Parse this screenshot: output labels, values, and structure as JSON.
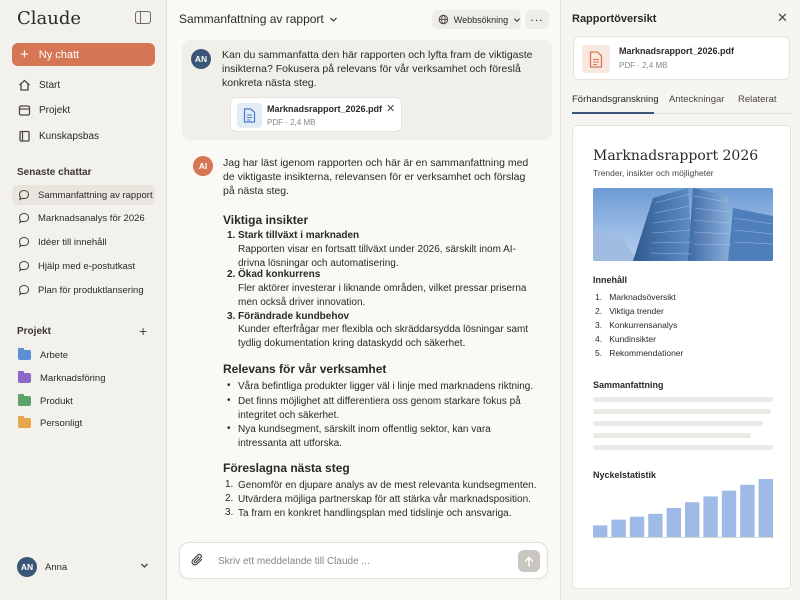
{
  "app": {
    "logo": "Claude"
  },
  "sidebar": {
    "new_chat": "Ny chatt",
    "nav": [
      {
        "label": "Start",
        "icon": "home-icon"
      },
      {
        "label": "Projekt",
        "icon": "folder-icon"
      },
      {
        "label": "Kunskapsbas",
        "icon": "book-icon"
      }
    ],
    "recent_title": "Senaste chattar",
    "recent": [
      "Sammanfattning av rapport",
      "Marknadsanalys för 2026",
      "Idéer till innehåll",
      "Hjälp med e-postutkast",
      "Plan för produktlansering"
    ],
    "projects_title": "Projekt",
    "projects": [
      {
        "label": "Arbete",
        "color": "#5b8fd6"
      },
      {
        "label": "Marknadsföring",
        "color": "#8c68c9"
      },
      {
        "label": "Produkt",
        "color": "#5aa36a"
      },
      {
        "label": "Personligt",
        "color": "#e7a64b"
      }
    ],
    "user": {
      "initials": "AN",
      "name": "Anna"
    }
  },
  "header": {
    "title": "Sammanfattning av rapport",
    "web_search": "Webbsökning"
  },
  "conversation": {
    "user": {
      "initials": "AN",
      "text": "Kan du sammanfatta den här rapporten och lyfta fram de viktigaste insikterna? Fokusera på relevans för vår verksamhet och föreslå konkreta nästa steg.",
      "attachment": {
        "name": "Marknadsrapport_2026.pdf",
        "meta": "PDF · 2,4 MB"
      }
    },
    "ai": {
      "initials": "AI",
      "intro": "Jag har läst igenom rapporten och här är en sammanfattning med de viktigaste insikterna, relevansen för er verksamhet och förslag på nästa steg.",
      "insights_heading": "Viktiga insikter",
      "insights": [
        {
          "title": "Stark tillväxt i marknaden",
          "body": "Rapporten visar en fortsatt tillväxt under 2026, särskilt inom AI-drivna lösningar och automatisering."
        },
        {
          "title": "Ökad konkurrens",
          "body": "Fler aktörer investerar i liknande områden, vilket pressar priserna men också driver innovation."
        },
        {
          "title": "Förändrade kundbehov",
          "body": "Kunder efterfrågar mer flexibla och skräddarsydda lösningar samt tydlig dokumentation kring dataskydd och säkerhet."
        }
      ],
      "relevance_heading": "Relevans för vår verksamhet",
      "relevance": [
        "Våra befintliga produkter ligger väl i linje med marknadens riktning.",
        "Det finns möjlighet att differentiera oss genom starkare fokus på integritet och säkerhet.",
        "Nya kundsegment, särskilt inom offentlig sektor, kan vara intressanta att utforska."
      ],
      "steps_heading": "Föreslagna nästa steg",
      "steps": [
        "Genomför en djupare analys av de mest relevanta kundsegmenten.",
        "Utvärdera möjliga partnerskap för att stärka vår marknadsposition.",
        "Ta fram en konkret handlingsplan med tidslinje och ansvariga."
      ]
    }
  },
  "composer": {
    "placeholder": "Skriv ett meddelande till Claude ..."
  },
  "panel": {
    "title": "Rapportöversikt",
    "file": {
      "name": "Marknadsrapport_2026.pdf",
      "meta": "PDF · 2,4 MB"
    },
    "tabs": [
      "Förhandsgranskning",
      "Anteckningar",
      "Relaterat"
    ],
    "preview": {
      "title": "Marknadsrapport 2026",
      "subtitle": "Trender, insikter och möjligheter",
      "toc_heading": "Innehåll",
      "toc": [
        "Marknadsöversikt",
        "Viktiga trender",
        "Konkurrensanalys",
        "Kundinsikter",
        "Rekommendationer"
      ],
      "summary_heading": "Sammanfattning",
      "stats_heading": "Nyckelstatistik",
      "stats_values": [
        2,
        3,
        3.5,
        4,
        5,
        6,
        7,
        8,
        9,
        10
      ]
    }
  },
  "colors": {
    "accent": "#d77655",
    "user_avatar": "#3b5578",
    "chart_bar": "#9dbbe6"
  }
}
